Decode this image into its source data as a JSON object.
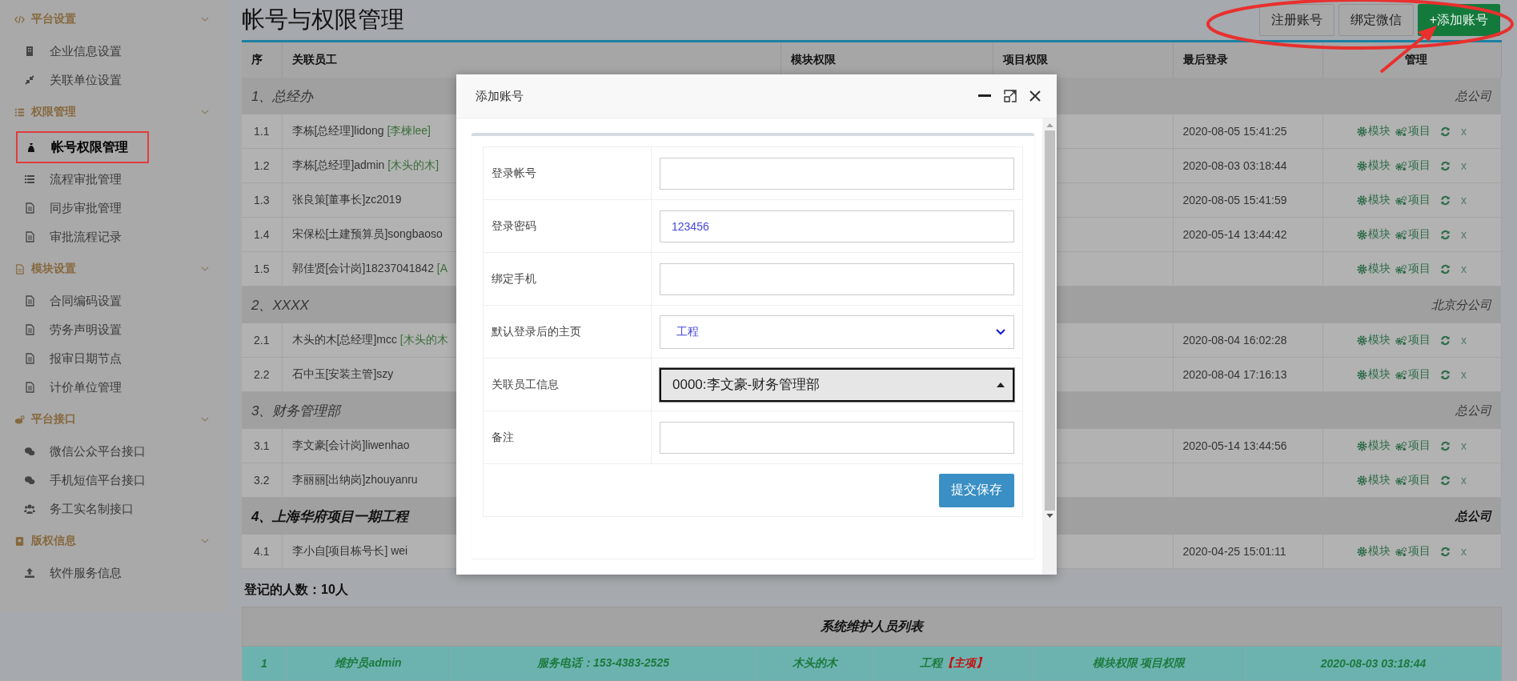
{
  "sidebar": {
    "sections": [
      {
        "title": "平台设置",
        "items": [
          {
            "label": "企业信息设置",
            "selected": false
          },
          {
            "label": "关联单位设置",
            "selected": false
          }
        ]
      },
      {
        "title": "权限管理",
        "items": [
          {
            "label": "帐号权限管理",
            "selected": true
          },
          {
            "label": "流程审批管理",
            "selected": false
          },
          {
            "label": "同步审批管理",
            "selected": false
          },
          {
            "label": "审批流程记录",
            "selected": false
          }
        ]
      },
      {
        "title": "模块设置",
        "items": [
          {
            "label": "合同编码设置",
            "selected": false
          },
          {
            "label": "劳务声明设置",
            "selected": false
          },
          {
            "label": "报审日期节点",
            "selected": false
          },
          {
            "label": "计价单位管理",
            "selected": false
          }
        ]
      },
      {
        "title": "平台接口",
        "items": [
          {
            "label": "微信公众平台接口",
            "selected": false
          },
          {
            "label": "手机短信平台接口",
            "selected": false
          },
          {
            "label": "务工实名制接口",
            "selected": false
          }
        ]
      },
      {
        "title": "版权信息",
        "items": [
          {
            "label": "软件服务信息",
            "selected": false
          }
        ]
      }
    ]
  },
  "page_title": "帐号与权限管理",
  "header_buttons": [
    {
      "label": "注册账号",
      "kind": "default"
    },
    {
      "label": "绑定微信",
      "kind": "default"
    },
    {
      "label": "+添加账号",
      "kind": "primary"
    }
  ],
  "table": {
    "columns": [
      "序",
      "关联员工",
      "模块权限",
      "项目权限",
      "最后登录",
      "管理"
    ],
    "groups": [
      {
        "title": "1、总经办",
        "company": "总公司",
        "emphasized": false,
        "rows": [
          {
            "seq": "1.1",
            "employee": "李栋[总经理]lidong",
            "alias": "[李楝lee]",
            "last_login": "2020-08-05 15:41:25",
            "actions": {
              "module": "模块",
              "project": "项目",
              "delete": "x"
            }
          },
          {
            "seq": "1.2",
            "employee": "李栋[总经理]admin",
            "alias": "[木头的木]",
            "last_login": "2020-08-03 03:18:44",
            "actions": {
              "module": "模块",
              "project": "项目",
              "delete": "x"
            }
          },
          {
            "seq": "1.3",
            "employee": "张良策[董事长]zc2019",
            "last_login": "2020-08-05 15:41:59",
            "actions": {
              "module": "模块",
              "project": "项目",
              "delete": "x"
            }
          },
          {
            "seq": "1.4",
            "employee": "宋保松[土建预算员]songbaoso",
            "last_login": "2020-05-14 13:44:42",
            "actions": {
              "module": "模块",
              "project": "项目",
              "delete": "x"
            }
          },
          {
            "seq": "1.5",
            "employee": "郭佳贤[会计岗]18237041842",
            "alias": "[A",
            "actions": {
              "module": "模块",
              "project": "项目",
              "delete": "x"
            }
          }
        ]
      },
      {
        "title": "2、XXXX",
        "company": "北京分公司",
        "emphasized": false,
        "rows": [
          {
            "seq": "2.1",
            "employee": "木头的木[总经理]mcc",
            "alias": "[木头的木",
            "last_login": "2020-08-04 16:02:28",
            "actions": {
              "module": "模块",
              "project": "项目",
              "delete": "x"
            }
          },
          {
            "seq": "2.2",
            "employee": "石中玉[安装主管]szy",
            "last_login": "2020-08-04 17:16:13",
            "actions": {
              "module": "模块",
              "project": "项目",
              "delete": "x"
            }
          }
        ]
      },
      {
        "title": "3、财务管理部",
        "company": "总公司",
        "emphasized": false,
        "rows": [
          {
            "seq": "3.1",
            "employee": "李文豪[会计岗]liwenhao",
            "last_login": "2020-05-14 13:44:56",
            "actions": {
              "module": "模块",
              "project": "项目",
              "delete": "x"
            }
          },
          {
            "seq": "3.2",
            "employee": "李丽丽[出纳岗]zhouyanru",
            "actions": {
              "module": "模块",
              "project": "项目",
              "delete": "x"
            }
          }
        ]
      },
      {
        "title": "4、上海华府项目一期工程",
        "company": "总公司",
        "emphasized": true,
        "rows": [
          {
            "seq": "4.1",
            "employee": "李小自[项目栋号长] wei",
            "last_login": "2020-04-25 15:01:11",
            "actions": {
              "module": "模块",
              "project": "项目",
              "delete": "x"
            }
          }
        ]
      }
    ]
  },
  "count_label": "登记的人数：10人",
  "maintenance": {
    "title": "系统维护人员列表",
    "rows": [
      {
        "seq": "1",
        "name": "维护员admin",
        "phone": "服务电话：153-4383-2525",
        "alias": "木头的木",
        "home": "工程",
        "home_tag": "【主项】",
        "permissions": "模块权限 项目权限",
        "last_login": "2020-08-03 03:18:44"
      }
    ]
  },
  "modal": {
    "title": "添加账号",
    "fields": [
      {
        "label": "登录帐号",
        "kind": "text",
        "focused": false
      },
      {
        "label": "登录密码",
        "kind": "text",
        "value": "123456",
        "focused": false
      },
      {
        "label": "绑定手机",
        "kind": "text",
        "focused": false
      },
      {
        "label": "默认登录后的主页",
        "kind": "select",
        "value": "工程",
        "focused": false
      },
      {
        "label": "关联员工信息",
        "kind": "combo",
        "value": "0000:李文豪-财务管理部",
        "focused": true
      },
      {
        "label": "备注",
        "kind": "text",
        "focused": false
      }
    ],
    "submit": "提交保存"
  }
}
